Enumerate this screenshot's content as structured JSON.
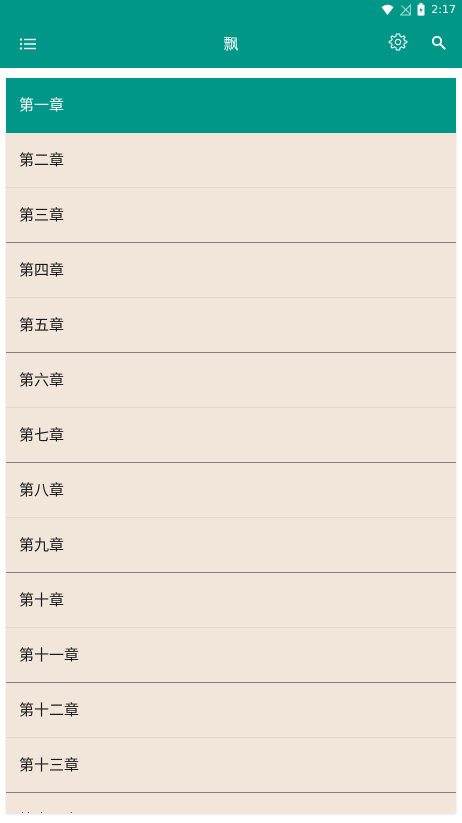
{
  "status_bar": {
    "time": "2:17",
    "icons": [
      "wifi-icon",
      "no-signal-icon",
      "battery-icon"
    ]
  },
  "app_bar": {
    "title": "飘",
    "icons": [
      "menu-icon",
      "settings-icon",
      "search-icon"
    ]
  },
  "chapters": [
    {
      "label": "第一章",
      "active": true
    },
    {
      "label": "第二章"
    },
    {
      "label": "第三章"
    },
    {
      "label": "第四章"
    },
    {
      "label": "第五章"
    },
    {
      "label": "第六章"
    },
    {
      "label": "第七章"
    },
    {
      "label": "第八章"
    },
    {
      "label": "第九章"
    },
    {
      "label": "第十章"
    },
    {
      "label": "第十一章"
    },
    {
      "label": "第十二章"
    },
    {
      "label": "第十三章"
    },
    {
      "label": "第十四章"
    }
  ],
  "colors": {
    "primary": "#009688",
    "list_background": "#f2e6da",
    "active_text": "#ffffff"
  }
}
